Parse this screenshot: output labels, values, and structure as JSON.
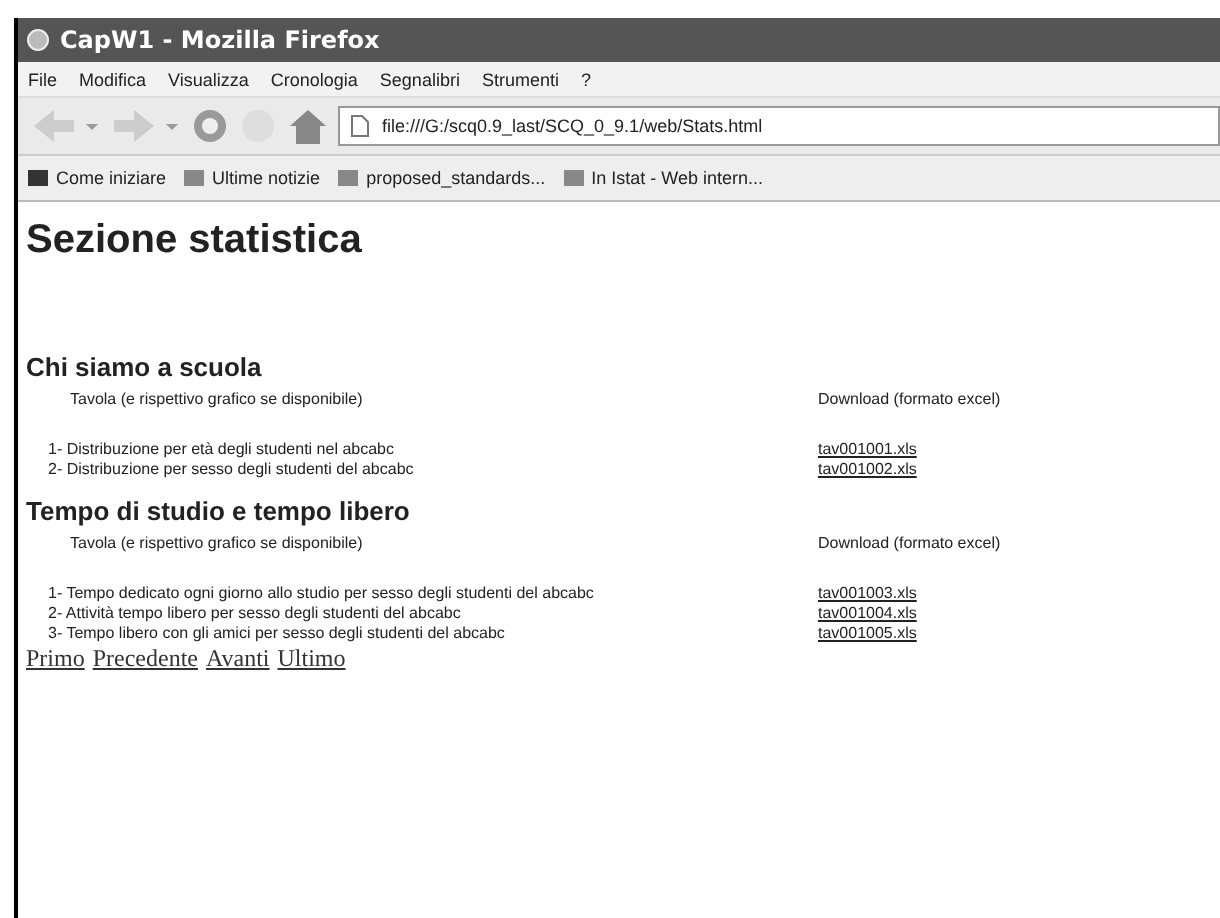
{
  "window": {
    "title": "CapW1 - Mozilla Firefox"
  },
  "menu": [
    "File",
    "Modifica",
    "Visualizza",
    "Cronologia",
    "Segnalibri",
    "Strumenti",
    "?"
  ],
  "address": {
    "value": "file:///G:/scq0.9_last/SCQ_0_9.1/web/Stats.html"
  },
  "bookmarks": [
    "Come iniziare",
    "Ultime notizie",
    "proposed_standards...",
    "In Istat - Web intern..."
  ],
  "page": {
    "heading": "Sezione statistica",
    "sections": [
      {
        "title": "Chi siamo a scuola",
        "col1": "Tavola (e rispettivo grafico se disponibile)",
        "col2": "Download (formato excel)",
        "rows": [
          {
            "label": "1- Distribuzione per età degli studenti nel abcabc",
            "file": "tav001001.xls"
          },
          {
            "label": "2- Distribuzione per sesso degli studenti del abcabc",
            "file": "tav001002.xls"
          }
        ]
      },
      {
        "title": "Tempo di studio e tempo libero",
        "col1": "Tavola (e rispettivo grafico se disponibile)",
        "col2": "Download (formato excel)",
        "rows": [
          {
            "label": "1- Tempo dedicato ogni giorno allo studio per sesso degli studenti del abcabc",
            "file": "tav001003.xls"
          },
          {
            "label": "2- Attività tempo libero per sesso degli studenti del abcabc",
            "file": "tav001004.xls"
          },
          {
            "label": "3- Tempo libero con gli amici per sesso degli studenti del abcabc",
            "file": "tav001005.xls"
          }
        ]
      }
    ],
    "pager": [
      "Primo",
      "Precedente",
      "Avanti",
      "Ultimo"
    ]
  }
}
